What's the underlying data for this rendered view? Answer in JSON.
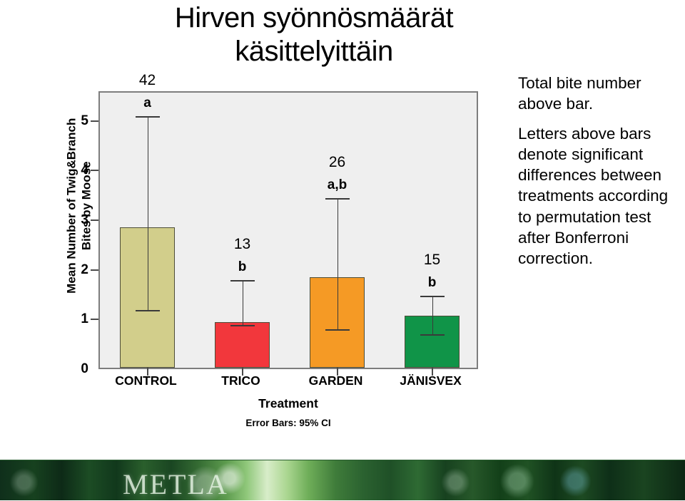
{
  "slide": {
    "title_lines": [
      "Hirven syönnösmäärät",
      "käsittelyittäin"
    ],
    "notes": [
      "Total bite number above bar.",
      "Letters above bars denote significant differences between treatments according to permutation test after Bonferroni correction."
    ],
    "banner_logo": "METLA"
  },
  "chart_data": {
    "type": "bar",
    "title": "",
    "xlabel": "Treatment",
    "ylabel": "Mean Number of Twig&Branch Bites by Moose",
    "ylim": [
      0,
      5.6
    ],
    "yticks": [
      0,
      1,
      2,
      3,
      4,
      5
    ],
    "ytick_labels": [
      "0",
      "1",
      "2",
      "3",
      "4",
      "5"
    ],
    "grid": false,
    "legend": "none",
    "error_note": "Error Bars: 95% CI",
    "categories": [
      "CONTROL",
      "TRICO",
      "GARDEN",
      "JÄNISVEX"
    ],
    "values": [
      2.83,
      0.92,
      1.83,
      1.05
    ],
    "err_low": [
      1.22,
      0.92,
      0.83,
      0.73
    ],
    "err_high": [
      5.12,
      1.83,
      3.47,
      1.51
    ],
    "total_bites": [
      "42",
      "13",
      "26",
      "15"
    ],
    "significance_letters": [
      "a",
      "b",
      "a,b",
      "b"
    ],
    "colors": [
      "#d2ce8b",
      "#f2373c",
      "#f59a25",
      "#109448"
    ],
    "bar_edge_color": "#4d4d38",
    "plot_background": "#efefef",
    "plot_border_color": "#7d7d7d"
  }
}
